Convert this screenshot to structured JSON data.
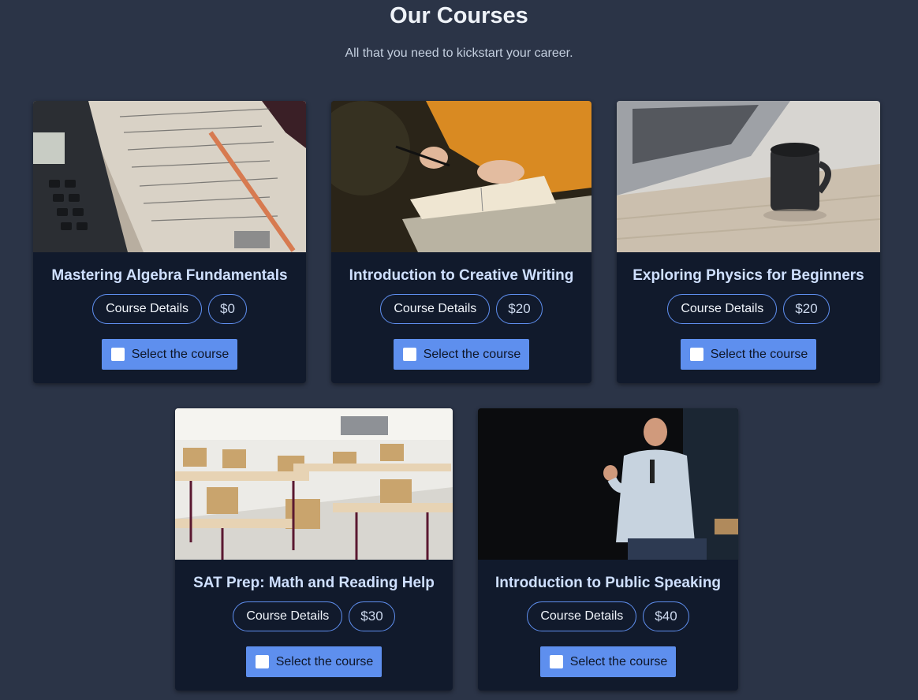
{
  "header": {
    "title": "Our Courses",
    "subtitle": "All that you need to kickstart your career."
  },
  "courses": [
    {
      "title": "Mastering Algebra Fundamentals",
      "details_label": "Course Details",
      "price": "$0",
      "select_label": "Select the course",
      "selected": false,
      "image": "calculator-math-notes-image"
    },
    {
      "title": "Introduction to Creative Writing",
      "details_label": "Course Details",
      "price": "$20",
      "select_label": "Select the course",
      "selected": false,
      "image": "writing-in-notebook-image"
    },
    {
      "title": "Exploring Physics for Beginners",
      "details_label": "Course Details",
      "price": "$20",
      "select_label": "Select the course",
      "selected": false,
      "image": "laptop-coffee-mug-image"
    },
    {
      "title": "SAT Prep: Math and Reading Help",
      "details_label": "Course Details",
      "price": "$30",
      "select_label": "Select the course",
      "selected": false,
      "image": "classroom-desks-image"
    },
    {
      "title": "Introduction to Public Speaking",
      "details_label": "Course Details",
      "price": "$40",
      "select_label": "Select the course",
      "selected": false,
      "image": "speaker-on-stage-image"
    }
  ],
  "colors": {
    "background": "#2b3447",
    "card": "#111a2c",
    "accent": "#5e8fee",
    "title": "#cfe0ff"
  }
}
